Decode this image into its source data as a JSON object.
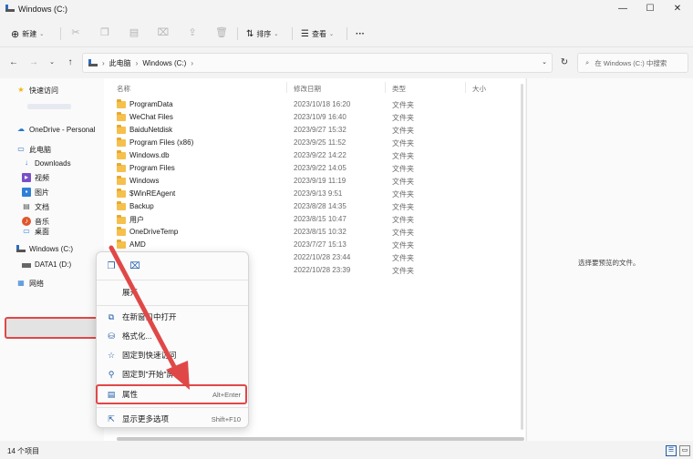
{
  "window": {
    "title": "Windows (C:)",
    "controls": [
      "—",
      "☐",
      "✕"
    ]
  },
  "toolbar": {
    "new_label": "新建",
    "sort_label": "排序",
    "view_label": "查看",
    "more_label": "···"
  },
  "address": {
    "breadcrumbs": [
      "此电脑",
      "Windows (C:)"
    ],
    "search_placeholder": "在 Windows (C:) 中搜索"
  },
  "nav": {
    "items": [
      {
        "label": "快速访问",
        "icon": "star-icon"
      },
      {
        "label": "OneDrive - Personal",
        "icon": "cloud-icon"
      },
      {
        "label": "此电脑",
        "icon": "pc-icon"
      },
      {
        "label": "Downloads",
        "icon": "download-icon"
      },
      {
        "label": "视频",
        "icon": "video-icon"
      },
      {
        "label": "图片",
        "icon": "picture-icon"
      },
      {
        "label": "文档",
        "icon": "document-icon"
      },
      {
        "label": "音乐",
        "icon": "music-icon"
      },
      {
        "label": "桌面",
        "icon": "desktop-icon"
      },
      {
        "label": "Windows (C:)",
        "icon": "drive-icon"
      },
      {
        "label": "DATA1 (D:)",
        "icon": "drive-icon"
      },
      {
        "label": "网络",
        "icon": "network-icon"
      }
    ]
  },
  "columns": {
    "name": "名称",
    "date": "修改日期",
    "type": "类型",
    "size": "大小"
  },
  "files": [
    {
      "name": "ProgramData",
      "date": "2023/10/18 16:20",
      "type": "文件夹"
    },
    {
      "name": "WeChat Files",
      "date": "2023/10/9 16:40",
      "type": "文件夹"
    },
    {
      "name": "BaiduNetdisk",
      "date": "2023/9/27 15:32",
      "type": "文件夹"
    },
    {
      "name": "Program Files (x86)",
      "date": "2023/9/25 11:52",
      "type": "文件夹"
    },
    {
      "name": "Windows.db",
      "date": "2023/9/22 14:22",
      "type": "文件夹"
    },
    {
      "name": "Program Files",
      "date": "2023/9/22 14:05",
      "type": "文件夹"
    },
    {
      "name": "Windows",
      "date": "2023/9/19 11:19",
      "type": "文件夹"
    },
    {
      "name": "$WinREAgent",
      "date": "2023/9/13 9:51",
      "type": "文件夹"
    },
    {
      "name": "Backup",
      "date": "2023/8/28 14:35",
      "type": "文件夹"
    },
    {
      "name": "用户",
      "date": "2023/8/15 10:47",
      "type": "文件夹"
    },
    {
      "name": "OneDriveTemp",
      "date": "2023/8/15 10:32",
      "type": "文件夹"
    },
    {
      "name": "AMD",
      "date": "2023/7/27 15:13",
      "type": "文件夹"
    },
    {
      "name": "",
      "date": "2022/10/28 23:44",
      "type": "文件夹"
    },
    {
      "name": "",
      "date": "2022/10/28 23:39",
      "type": "文件夹"
    }
  ],
  "preview": {
    "empty_text": "选择要预览的文件。"
  },
  "status": {
    "item_count": "14 个项目"
  },
  "context_menu": {
    "expand": "展开",
    "open_new_window": "在新窗口中打开",
    "format": "格式化...",
    "pin_quick_access": "固定到快速访问",
    "pin_start": "固定到\"开始\"屏幕",
    "properties": "属性",
    "properties_shortcut": "Alt+Enter",
    "more_options": "显示更多选项",
    "more_options_shortcut": "Shift+F10"
  },
  "colors": {
    "highlight": "#e04848",
    "folder": "#f5c04c",
    "accent": "#1e5aa8"
  }
}
